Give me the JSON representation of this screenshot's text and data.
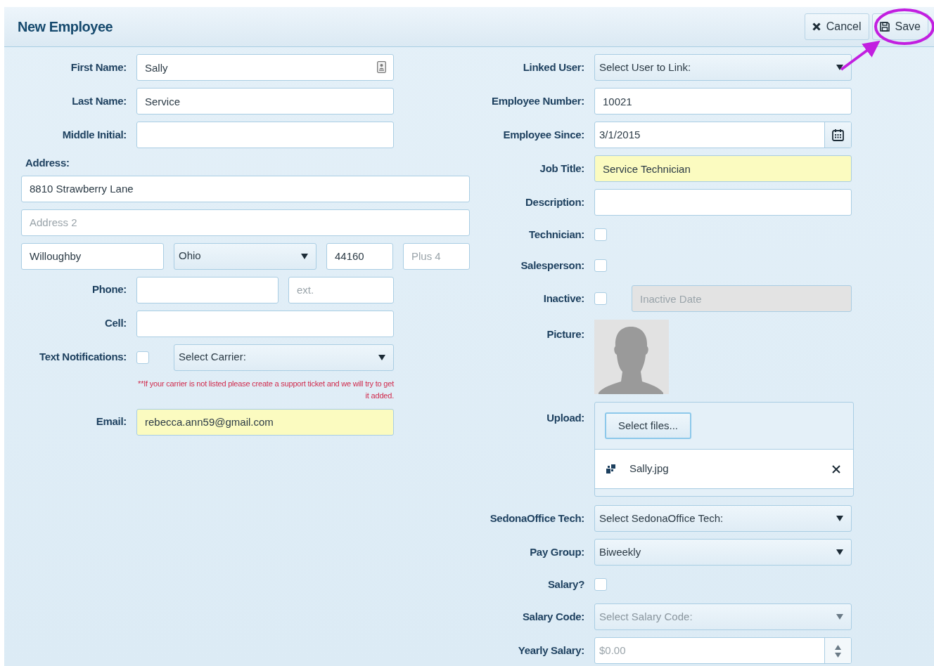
{
  "header": {
    "title": "New Employee",
    "buttons": [
      {
        "label": "Cancel",
        "kind": "cancel"
      },
      {
        "label": "Save",
        "kind": "save"
      }
    ]
  },
  "annotation": {
    "kind": "circle-arrow"
  },
  "left_fields": [
    {
      "kind": "text-card",
      "label": "First Name:",
      "value": "Sally"
    },
    {
      "kind": "text",
      "label": "Last Name:",
      "value": "Service"
    },
    {
      "kind": "text",
      "label": "Middle Initial:"
    },
    {
      "kind": "address",
      "label": "Address:",
      "line1": "8810 Strawberry Lane",
      "line2_placeholder": "Address 2",
      "city": "Willoughby",
      "state": "Ohio",
      "zip": "44160",
      "plus4_placeholder": "Plus 4"
    },
    {
      "kind": "phone",
      "label": "Phone:",
      "ext_placeholder": "ext."
    },
    {
      "kind": "text",
      "label": "Cell:"
    },
    {
      "kind": "checkbox-select",
      "label": "Text Notifications:",
      "checked": false,
      "select_value": "Select Carrier:",
      "note": "**If your carrier is not listed please create a support ticket and we will try to get it added."
    },
    {
      "kind": "text",
      "label": "Email:",
      "value": "rebecca.ann59@gmail.com",
      "highlighted": true
    }
  ],
  "right_fields": [
    {
      "kind": "select",
      "label": "Linked User:",
      "value": "Select User to Link:"
    },
    {
      "kind": "text",
      "label": "Employee Number:",
      "value": "10021"
    },
    {
      "kind": "date",
      "label": "Employee Since:",
      "value": "3/1/2015"
    },
    {
      "kind": "text",
      "label": "Job Title:",
      "value": "Service Technician",
      "highlighted": true
    },
    {
      "kind": "text",
      "label": "Description:"
    },
    {
      "kind": "checkbox",
      "label": "Technician:",
      "checked": false
    },
    {
      "kind": "checkbox",
      "label": "Salesperson:",
      "checked": false
    },
    {
      "kind": "checkbox-date",
      "label": "Inactive:",
      "checked": false,
      "date_placeholder": "Inactive Date",
      "date_disabled": true
    },
    {
      "kind": "picture",
      "label": "Picture:"
    },
    {
      "kind": "upload",
      "label": "Upload:",
      "button": "Select files...",
      "files": [
        {
          "name": "Sally.jpg"
        }
      ]
    },
    {
      "kind": "select",
      "label": "SedonaOffice Tech:",
      "value": "Select SedonaOffice Tech:"
    },
    {
      "kind": "select",
      "label": "Pay Group:",
      "value": "Biweekly"
    },
    {
      "kind": "checkbox",
      "label": "Salary?",
      "checked": false
    },
    {
      "kind": "select",
      "label": "Salary Code:",
      "value": "Select Salary Code:",
      "disabled": true
    },
    {
      "kind": "number",
      "label": "Yearly Salary:",
      "placeholder": "$0.00"
    }
  ]
}
